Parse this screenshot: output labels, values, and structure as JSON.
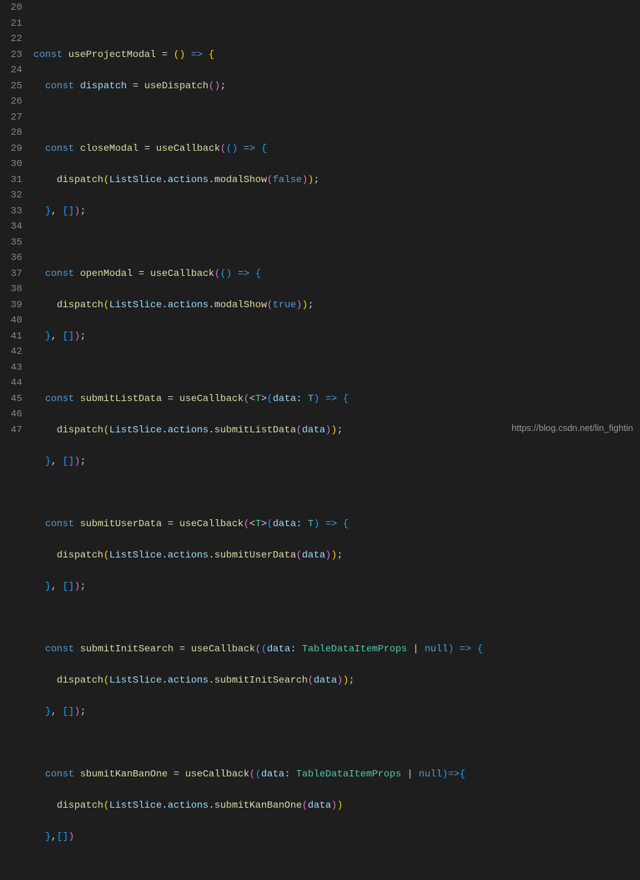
{
  "watermark": "https://blog.csdn.net/lin_fightin",
  "line_numbers": [
    "20",
    "21",
    "22",
    "23",
    "24",
    "25",
    "26",
    "27",
    "28",
    "29",
    "30",
    "31",
    "32",
    "33",
    "34",
    "35",
    "36",
    "37",
    "38",
    "39",
    "40",
    "41",
    "42",
    "43",
    "44",
    "45",
    "46",
    "47"
  ],
  "tokens": {
    "const": "const",
    "useProjectModal": "useProjectModal",
    "dispatch": "dispatch",
    "useDispatch": "useDispatch",
    "closeModal": "closeModal",
    "useCallback": "useCallback",
    "ListSlice": "ListSlice",
    "actions": "actions",
    "modalShow": "modalShow",
    "false": "false",
    "openModal": "openModal",
    "true": "true",
    "submitListData": "submitListData",
    "T": "T",
    "data": "data",
    "submitUserData": "submitUserData",
    "submitInitSearch": "submitInitSearch",
    "TableDataItemProps": "TableDataItemProps",
    "null": "null",
    "sbumitKanBanOne": "sbumitKanBanOne",
    "submitKanBanOne": "submitKanBanOne",
    "arrow": "=>"
  },
  "code_plain": [
    "",
    "const useProjectModal = () => {",
    "  const dispatch = useDispatch();",
    "",
    "  const closeModal = useCallback(() => {",
    "    dispatch(ListSlice.actions.modalShow(false));",
    "  }, []);",
    "",
    "  const openModal = useCallback(() => {",
    "    dispatch(ListSlice.actions.modalShow(true));",
    "  }, []);",
    "",
    "  const submitListData = useCallback(<T>(data: T) => {",
    "    dispatch(ListSlice.actions.submitListData(data));",
    "  }, []);",
    "",
    "  const submitUserData = useCallback(<T>(data: T) => {",
    "    dispatch(ListSlice.actions.submitUserData(data));",
    "  }, []);",
    "",
    "  const submitInitSearch = useCallback((data: TableDataItemProps | null) => {",
    "    dispatch(ListSlice.actions.submitInitSearch(data));",
    "  }, []);",
    "",
    "  const sbumitKanBanOne = useCallback((data: TableDataItemProps | null)=>{",
    "    dispatch(ListSlice.actions.submitKanBanOne(data))",
    "  },[])",
    ""
  ]
}
